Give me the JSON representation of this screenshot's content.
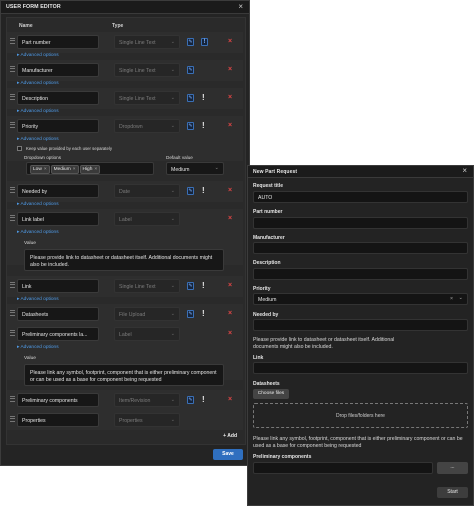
{
  "editor": {
    "title": "USER FORM EDITOR",
    "close_icon": "close-icon",
    "col_name": "Name",
    "col_type": "Type",
    "advanced": "Advanced options",
    "rows": [
      {
        "name": "Part number",
        "type": "Single Line Text"
      },
      {
        "name": "Manufacturer",
        "type": "Single Line Text"
      },
      {
        "name": "Description",
        "type": "Single Line Text"
      },
      {
        "name": "Priority",
        "type": "Dropdown"
      },
      {
        "name": "Needed by",
        "type": "Date"
      },
      {
        "name": "Link label",
        "type": "Label"
      },
      {
        "name": "Link",
        "type": "Single Line Text"
      },
      {
        "name": "Datasheets",
        "type": "File Upload"
      },
      {
        "name": "Preliminary components la...",
        "type": "Label"
      },
      {
        "name": "Preliminary components",
        "type": "Item/Revision"
      },
      {
        "name": "Properties",
        "type": "Properties"
      }
    ],
    "keep_value_label": "Keep value provided by each user separately",
    "dropdown_options_label": "Dropdown options",
    "dropdown_options": [
      "Low",
      "Medium",
      "High"
    ],
    "default_value_label": "Default value",
    "default_value": "Medium",
    "value_label": "Value",
    "link_label_value": "Please provide link to datasheet or datasheet itself. Additional documents might also be included.",
    "prelim_label_value": "Please link any symbol, footprint, component that is either preliminary component  or can be used as a base for component being requested",
    "add_button": "+ Add",
    "save_button": "Save",
    "exclaim": "!",
    "required_mark": "!",
    "del_mark": "×",
    "edit_mark": "✎",
    "chev": "⌄",
    "remove_chip": "×"
  },
  "request": {
    "title": "New Part Request",
    "close_icon": "close-icon",
    "request_title_label": "Request title",
    "request_title_value": "AUTO",
    "part_number_label": "Part number",
    "manufacturer_label": "Manufacturer",
    "description_label": "Description",
    "priority_label": "Priority",
    "priority_value": "Medium",
    "needed_by_label": "Needed by",
    "link_text": "Please provide link to datasheet or datasheet itself. Additional documents might also be included.",
    "link_label": "Link",
    "datasheets_label": "Datasheets",
    "choose_files": "Choose files",
    "drop_files": "Drop files/folders here",
    "prelim_text": "Please link any symbol, footprint, component that is either preliminary component or can be used as a base for component being requested",
    "prelim_label": "Preliminary components",
    "browse_button": "...",
    "start_button": "Start",
    "clear_mark": "×",
    "chev": "⌄"
  },
  "colors": {
    "accent": "#2f6fbf",
    "link": "#4f9be8",
    "danger": "#e04545",
    "background": "#242424"
  }
}
